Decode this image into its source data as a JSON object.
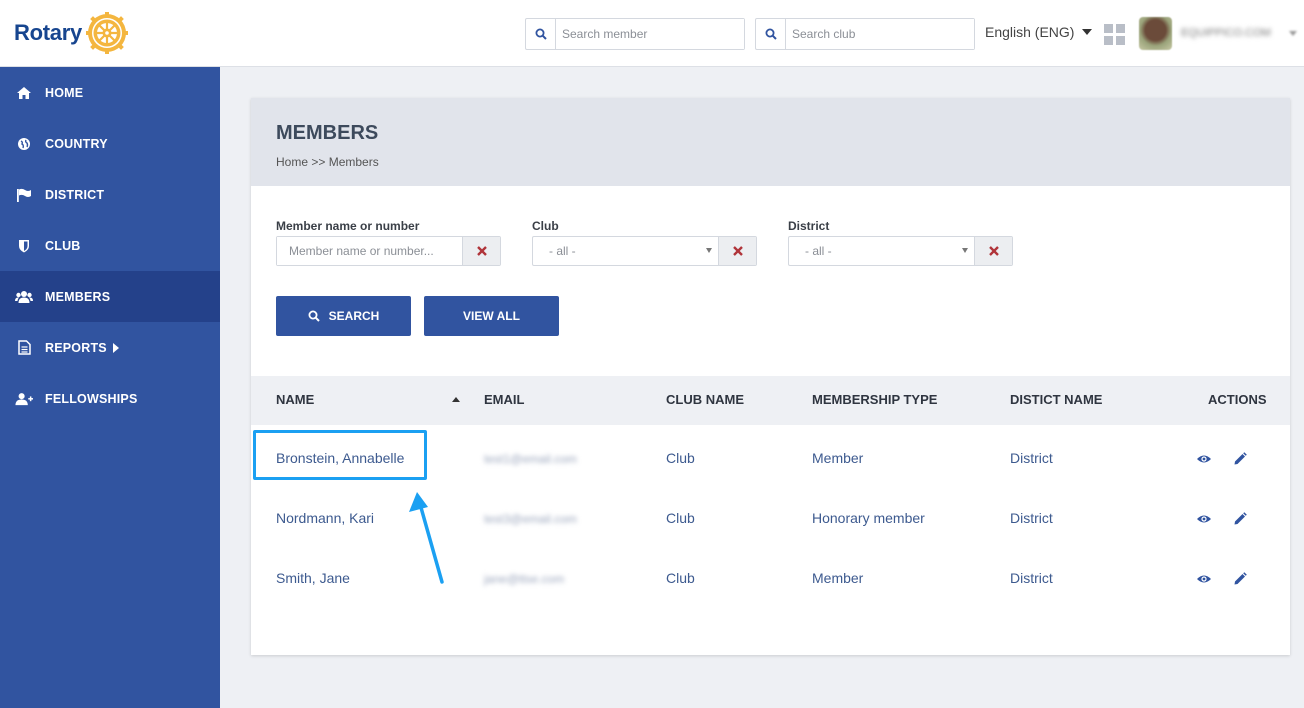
{
  "brand": {
    "name": "Rotary"
  },
  "header": {
    "search_member_placeholder": "Search member",
    "search_club_placeholder": "Search club",
    "language": "English (ENG)",
    "username": "EQUIPPICO.COM"
  },
  "sidebar": {
    "items": [
      {
        "label": "HOME",
        "icon": "home-icon"
      },
      {
        "label": "COUNTRY",
        "icon": "globe-icon"
      },
      {
        "label": "DISTRICT",
        "icon": "flag-icon"
      },
      {
        "label": "CLUB",
        "icon": "shield-icon"
      },
      {
        "label": "MEMBERS",
        "icon": "users-icon",
        "active": true
      },
      {
        "label": "REPORTS",
        "icon": "document-icon",
        "has_submenu": true
      },
      {
        "label": "FELLOWSHIPS",
        "icon": "user-plus-icon"
      }
    ]
  },
  "page": {
    "title": "MEMBERS",
    "breadcrumb": "Home >> Members"
  },
  "filters": {
    "member_label": "Member name or number",
    "member_placeholder": "Member name or number...",
    "club_label": "Club",
    "club_value": "- all -",
    "district_label": "District",
    "district_value": "- all -"
  },
  "buttons": {
    "search": "SEARCH",
    "view_all": "VIEW ALL"
  },
  "table": {
    "columns": [
      "NAME",
      "EMAIL",
      "CLUB NAME",
      "MEMBERSHIP TYPE",
      "DISTICT NAME",
      "ACTIONS"
    ],
    "rows": [
      {
        "name": "Bronstein, Annabelle",
        "email": "test1@email.com",
        "club": "Club",
        "type": "Member",
        "district": "District"
      },
      {
        "name": "Nordmann, Kari",
        "email": "test3@email.com",
        "club": "Club",
        "type": "Honorary member",
        "district": "District"
      },
      {
        "name": "Smith, Jane",
        "email": "jane@ttse.com",
        "club": "Club",
        "type": "Member",
        "district": "District"
      }
    ]
  },
  "colors": {
    "sidebar": "#3154a0",
    "sidebar_active": "#24418a",
    "accent": "#3154a0",
    "link": "#3d5a8f",
    "highlight": "#1ba0f2",
    "clear_x": "#b0343a"
  }
}
